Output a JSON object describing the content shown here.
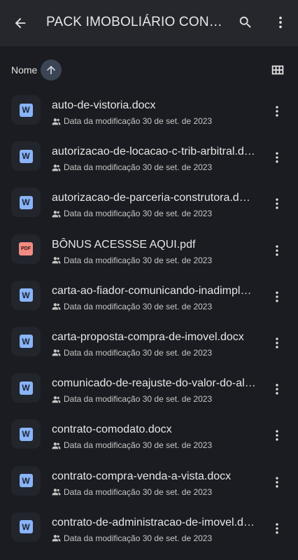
{
  "header": {
    "title": "PACK IMOBOLIÁRIO CONTRATOS",
    "icons": {
      "back": "arrow-back-icon",
      "search": "search-icon",
      "more": "more-vert-icon"
    }
  },
  "sort": {
    "label": "Nome",
    "direction": "ascending",
    "view_toggle_icon": "grid-view-icon"
  },
  "files": [
    {
      "name": "auto-de-vistoria.docx",
      "type": "word",
      "meta": "Data da modificação 30 de set. de 2023"
    },
    {
      "name": "autorizacao-de-locacao-c-trib-arbitral.docx",
      "type": "word",
      "meta": "Data da modificação 30 de set. de 2023"
    },
    {
      "name": "autorizacao-de-parceria-construtora.docx",
      "type": "word",
      "meta": "Data da modificação 30 de set. de 2023"
    },
    {
      "name": "BÔNUS ACESSSE AQUI.pdf",
      "type": "pdf",
      "meta": "Data da modificação 30 de set. de 2023"
    },
    {
      "name": "carta-ao-fiador-comunicando-inadimplencia.docx",
      "type": "word",
      "meta": "Data da modificação 30 de set. de 2023"
    },
    {
      "name": "carta-proposta-compra-de-imovel.docx",
      "type": "word",
      "meta": "Data da modificação 30 de set. de 2023"
    },
    {
      "name": "comunicado-de-reajuste-do-valor-do-aluguel.docx",
      "type": "word",
      "meta": "Data da modificação 30 de set. de 2023"
    },
    {
      "name": "contrato-comodato.docx",
      "type": "word",
      "meta": "Data da modificação 30 de set. de 2023"
    },
    {
      "name": "contrato-compra-venda-a-vista.docx",
      "type": "word",
      "meta": "Data da modificação 30 de set. de 2023"
    },
    {
      "name": "contrato-de-administracao-de-imovel.docx",
      "type": "word",
      "meta": "Data da modificação 30 de set. de 2023"
    }
  ],
  "badges": {
    "word": "W",
    "pdf": "PDF"
  },
  "colors": {
    "background": "#1b1c21",
    "appbar": "#25272d",
    "word_badge": "#8ab4f8",
    "pdf_badge": "#f28b82",
    "sort_button": "#3b4553"
  }
}
